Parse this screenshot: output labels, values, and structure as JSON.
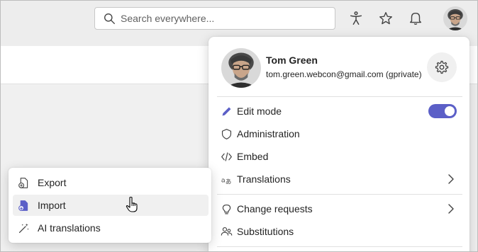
{
  "topbar": {
    "search_placeholder": "Search everywhere...",
    "icons": [
      "accessibility-icon",
      "favorites-icon",
      "notifications-icon"
    ]
  },
  "profile_menu": {
    "name": "Tom Green",
    "email": "tom.green.webcon@gmail.com (gprivate)",
    "items": [
      {
        "label": "Edit mode",
        "icon": "pencil-icon",
        "toggle": true
      },
      {
        "label": "Administration",
        "icon": "shield-icon"
      },
      {
        "label": "Embed",
        "icon": "code-icon"
      },
      {
        "label": "Translations",
        "icon": "translate-icon",
        "submenu": true
      },
      {
        "label": "Change requests",
        "icon": "lightbulb-icon",
        "submenu": true
      },
      {
        "label": "Substitutions",
        "icon": "people-icon"
      }
    ]
  },
  "translations_submenu": {
    "items": [
      {
        "label": "Export",
        "icon": "export-icon"
      },
      {
        "label": "Import",
        "icon": "import-icon",
        "hovered": true
      },
      {
        "label": "AI translations",
        "icon": "magic-wand-icon"
      }
    ]
  },
  "colors": {
    "accent": "#5b5fc7",
    "background": "#ededed",
    "panel": "#ffffff",
    "hover": "#f0f0f0"
  }
}
